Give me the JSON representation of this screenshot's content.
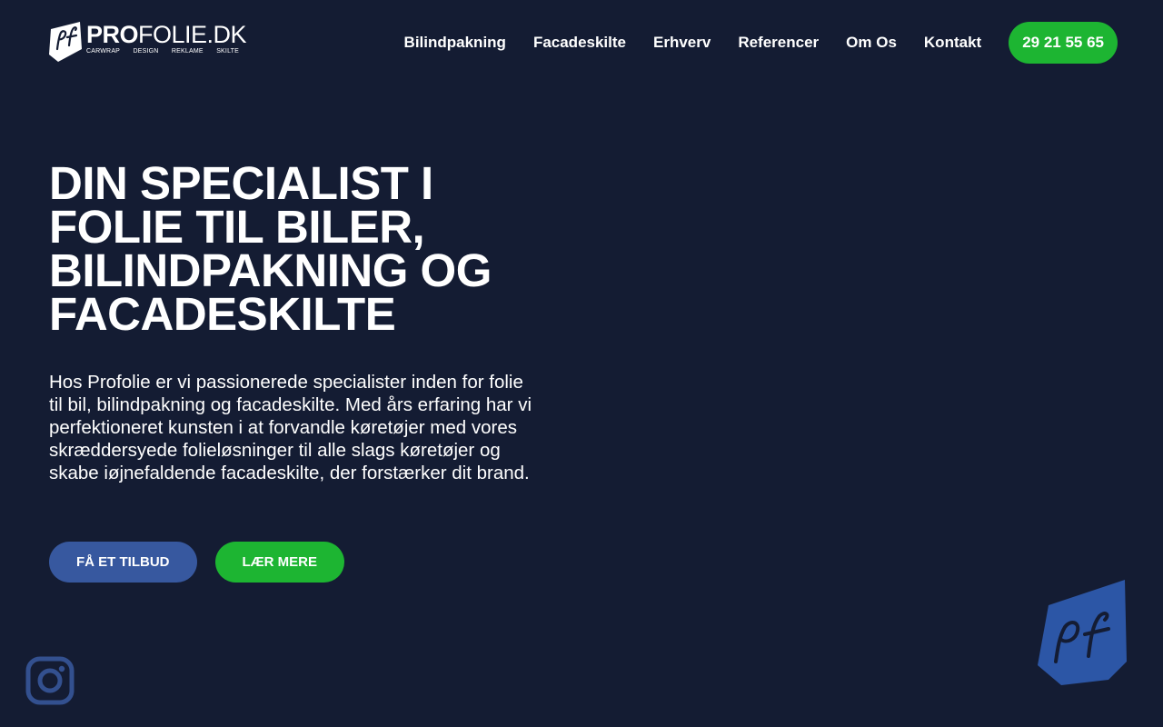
{
  "brand": {
    "logo_main": "PRO",
    "logo_rest": "FOLIE.DK",
    "logo_tags": [
      "CARWRAP",
      "DESIGN",
      "REKLAME",
      "SKILTE"
    ],
    "logo_icon": "pf-logo-icon"
  },
  "nav": {
    "items": [
      "Bilindpakning",
      "Facadeskilte",
      "Erhverv",
      "Referencer",
      "Om Os",
      "Kontakt"
    ],
    "phone": "29 21 55 65"
  },
  "hero": {
    "title": "DIN SPECIALIST I FOLIE TIL BILER, BILINDPAKNING OG FACADESKILTE",
    "text": "Hos Profolie er vi passionerede specialister inden for folie til bil, bilindpakning og facadeskilte. Med års erfaring har vi perfektioneret kunsten i at forvandle køretøjer med vores skræddersyede folieløsninger til alle slags køretøjer og skabe iøjnefaldende facadeskilte, der forstærker dit brand.",
    "cta_quote": "FÅ ET TILBUD",
    "cta_more": "LÆR MERE"
  },
  "social": {
    "icon": "instagram-icon"
  },
  "badge": {
    "icon": "pf-badge-icon"
  },
  "colors": {
    "background": "#141c33",
    "accent_green": "#1db532",
    "accent_blue": "#37589f",
    "text": "#ffffff"
  }
}
